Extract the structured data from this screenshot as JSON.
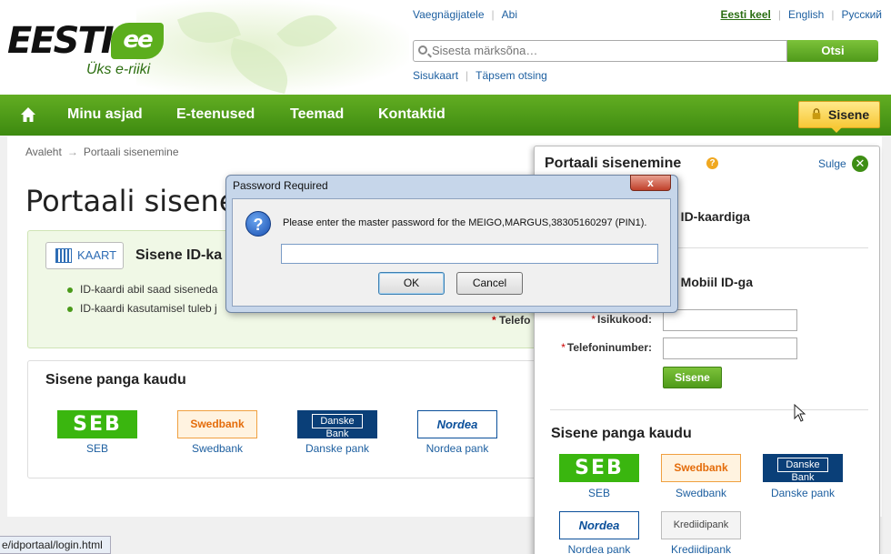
{
  "header": {
    "logo_text": "EESTI",
    "logo_ee": "ee",
    "tagline": "Üks e-riiki",
    "top_links": [
      "Vaegnägijatele",
      "Abi"
    ],
    "languages": [
      "Eesti keel",
      "English",
      "Русский"
    ],
    "search_placeholder": "Sisesta märksõna…",
    "search_button": "Otsi",
    "sub_links": [
      "Sisukaart",
      "Täpsem otsing"
    ]
  },
  "nav": {
    "items": [
      "Minu asjad",
      "E-teenused",
      "Teemad",
      "Kontaktid"
    ],
    "login_button": "Sisene"
  },
  "main": {
    "breadcrumb": [
      "Avaleht",
      "Portaali sisenemine"
    ],
    "breadcrumb_sep": "→",
    "page_title": "Portaali sisene",
    "id_logo": "KAART",
    "id_title": "Sisene ID-ka",
    "bullets": [
      "ID-kaardi abil saad siseneda",
      "ID-kaardi kasutamisel tuleb j"
    ],
    "phone_label_fragment": "Telefo",
    "banks_title": "Sisene panga kaudu",
    "banks": [
      {
        "logo": "SEB",
        "name": "SEB"
      },
      {
        "logo": "Swedbank",
        "name": "Swedbank"
      },
      {
        "logo_top": "Danske",
        "logo_bottom": "Bank",
        "name": "Danske pank"
      },
      {
        "logo": "Nordea",
        "name": "Nordea pank"
      }
    ]
  },
  "panel": {
    "title": "Portaali sisenemine",
    "close_label": "Sulge",
    "id_heading": "e ID-kaardiga",
    "mobile_heading": "e Mobiil ID-ga",
    "isikukood_label": "Isikukood:",
    "phone_label": "Telefoninumber:",
    "submit_button": "Sisene",
    "banks_title": "Sisene panga kaudu",
    "banks": [
      {
        "logo": "SEB",
        "name": "SEB"
      },
      {
        "logo": "Swedbank",
        "name": "Swedbank"
      },
      {
        "logo_top": "Danske",
        "logo_bottom": "Bank",
        "name": "Danske pank"
      },
      {
        "logo": "Nordea",
        "name": "Nordea pank"
      },
      {
        "logo": "Krediidipank",
        "name": "Krediidipank"
      }
    ]
  },
  "dialog": {
    "title": "Password Required",
    "close": "x",
    "message": "Please enter the master password for the MEIGO,MARGUS,38305160297 (PIN1).",
    "password_value": "",
    "ok": "OK",
    "cancel": "Cancel"
  },
  "status_bar": "e/idportaal/login.html",
  "colors": {
    "brand_green": "#4f9a1a",
    "accent_yellow": "#f7c836",
    "link_blue": "#1d5fa0"
  }
}
